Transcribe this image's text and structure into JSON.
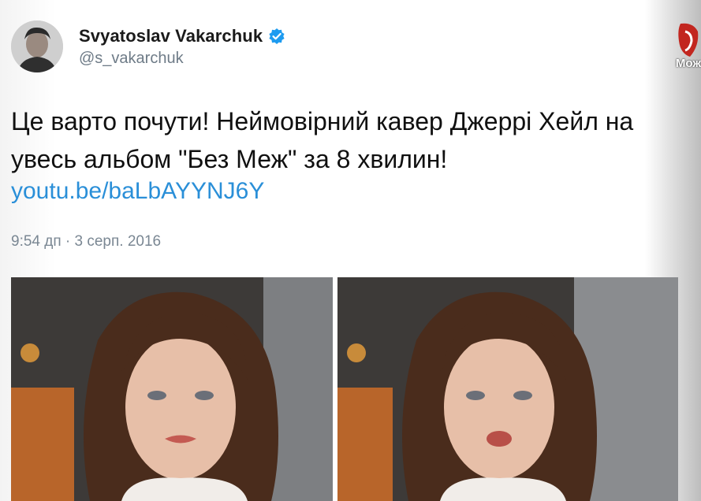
{
  "author": {
    "display_name": "Svyatoslav Vakarchuk",
    "handle": "@s_vakarchuk",
    "verified_icon": "verified-badge-icon",
    "avatar_icon": "avatar-photo"
  },
  "tweet": {
    "line1": "Це варто почути! Неймовірний кавер Джеррі Хейл на",
    "line2": "увесь альбом \"Без Меж\" за 8 хвилин!",
    "link": "youtu.be/baLbAYYNJ6Y",
    "timestamp": "9:54 дп · 3 серп. 2016"
  },
  "media": [
    {
      "name": "video-thumbnail-left",
      "icon": "video-still-woman"
    },
    {
      "name": "video-thumbnail-right",
      "icon": "video-still-woman"
    }
  ],
  "overlay": {
    "channel_label": "Мож",
    "logo_icon": "tv-channel-logo-icon"
  },
  "colors": {
    "link": "#2a8fd8",
    "verified": "#1d9bf0",
    "handle": "#6e7b87",
    "text": "#101010"
  }
}
